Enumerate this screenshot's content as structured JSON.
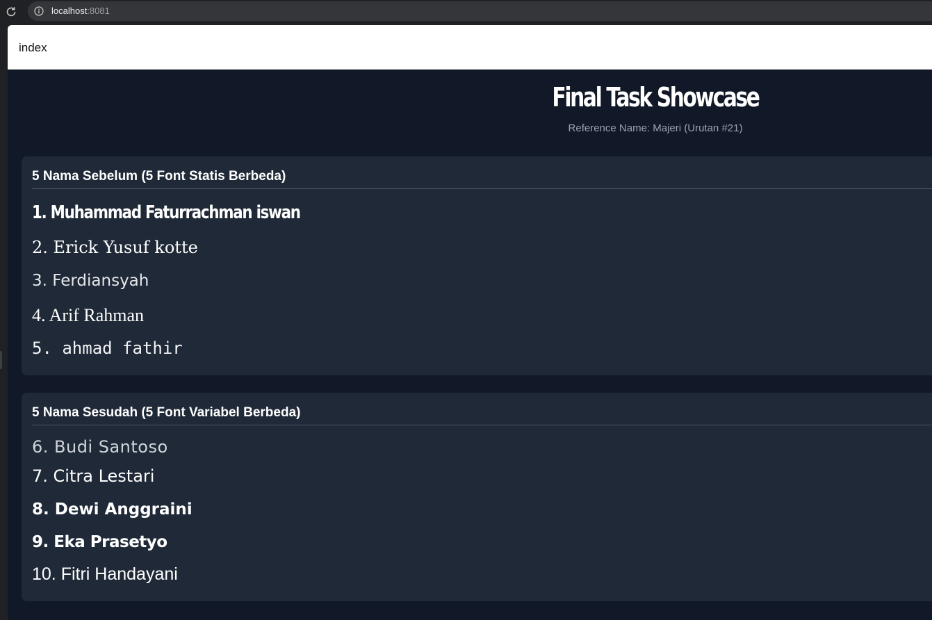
{
  "browser": {
    "url_host": "localhost",
    "url_port": ":8081"
  },
  "page": {
    "tab_title": "index"
  },
  "header": {
    "title": "Final Task Showcase",
    "subtitle": "Reference Name: Majeri (Urutan #21)"
  },
  "sections": [
    {
      "heading": "5 Nama Sebelum (5 Font Statis Berbeda)",
      "names": [
        "1. Muhammad Faturrachman iswan",
        "2. Erick Yusuf kotte",
        "3. Ferdiansyah",
        "4. Arif Rahman",
        "5. ahmad fathir"
      ]
    },
    {
      "heading": "5 Nama Sesudah (5 Font Variabel Berbeda)",
      "names": [
        "6. Budi Santoso",
        "7. Citra Lestari",
        "8. Dewi Anggraini",
        "9. Eka Prasetyo",
        "10. Fitri Handayani"
      ]
    }
  ],
  "icons": {
    "reload": "reload-icon",
    "info": "info-icon"
  },
  "colors": {
    "app_background": "#111827",
    "card_background": "#1f2937",
    "text": "#ffffff",
    "muted_text": "#9ca3af"
  }
}
